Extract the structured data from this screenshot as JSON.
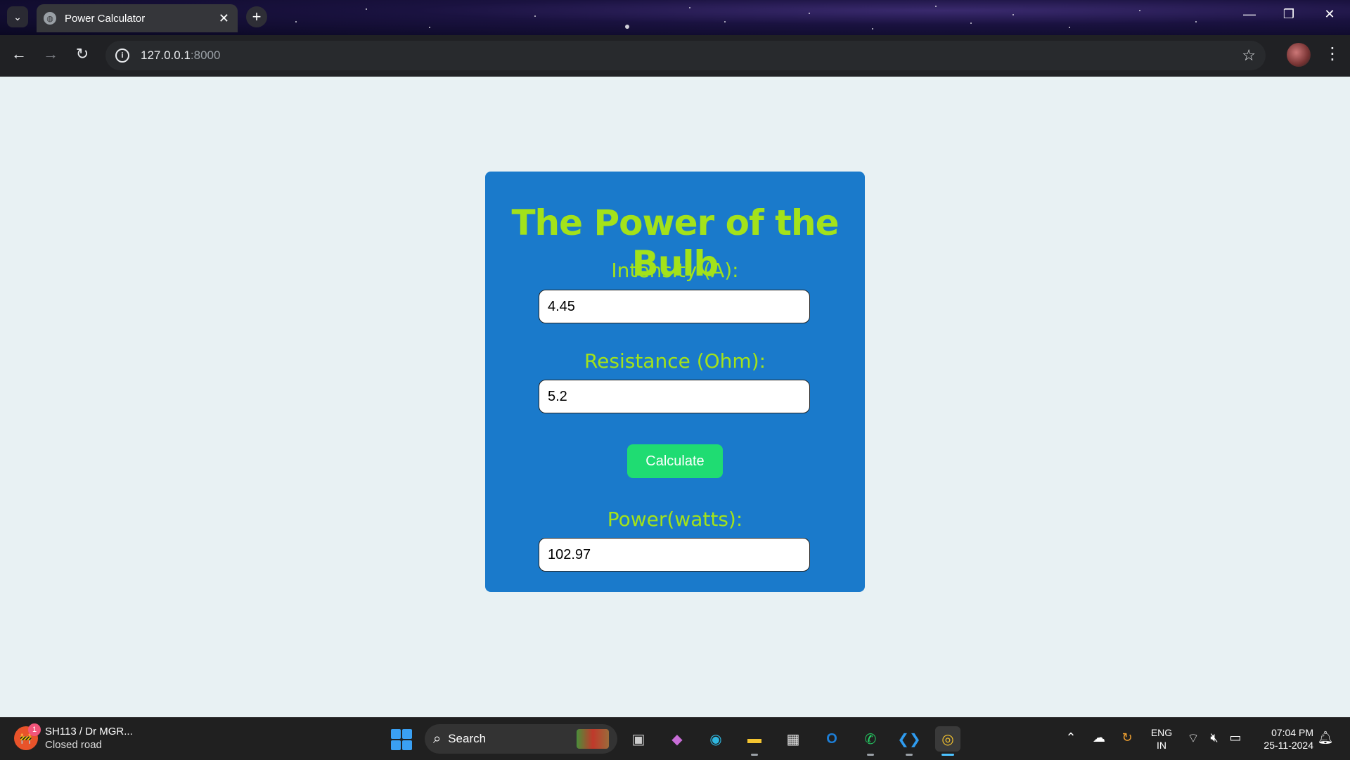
{
  "browser": {
    "tab_title": "Power Calculator",
    "tab_close": "✕",
    "new_tab": "+",
    "url_host": "127.0.0.1",
    "url_port": ":8000"
  },
  "page": {
    "title": "The Power of the Bulb",
    "intensity_label": "Intensity (A):",
    "intensity_value": "4.45",
    "resistance_label": "Resistance (Ohm):",
    "resistance_value": "5.2",
    "calculate_label": "Calculate",
    "power_label": "Power(watts):",
    "power_value": "102.97",
    "colors": {
      "background": "#e8f1f3",
      "card": "#1a7acb",
      "label": "#a3e21a",
      "button": "#1fdc72"
    }
  },
  "taskbar": {
    "widget_badge": "1",
    "widget_title": "SH113 / Dr MGR...",
    "widget_subtitle": "Closed road",
    "search_placeholder": "Search",
    "language_line1": "ENG",
    "language_line2": "IN",
    "time": "07:04 PM",
    "date": "25-11-2024",
    "apps": [
      "task-view",
      "copilot",
      "edge",
      "file-explorer",
      "microsoft-store",
      "outlook",
      "whatsapp",
      "vscode",
      "chrome"
    ]
  }
}
